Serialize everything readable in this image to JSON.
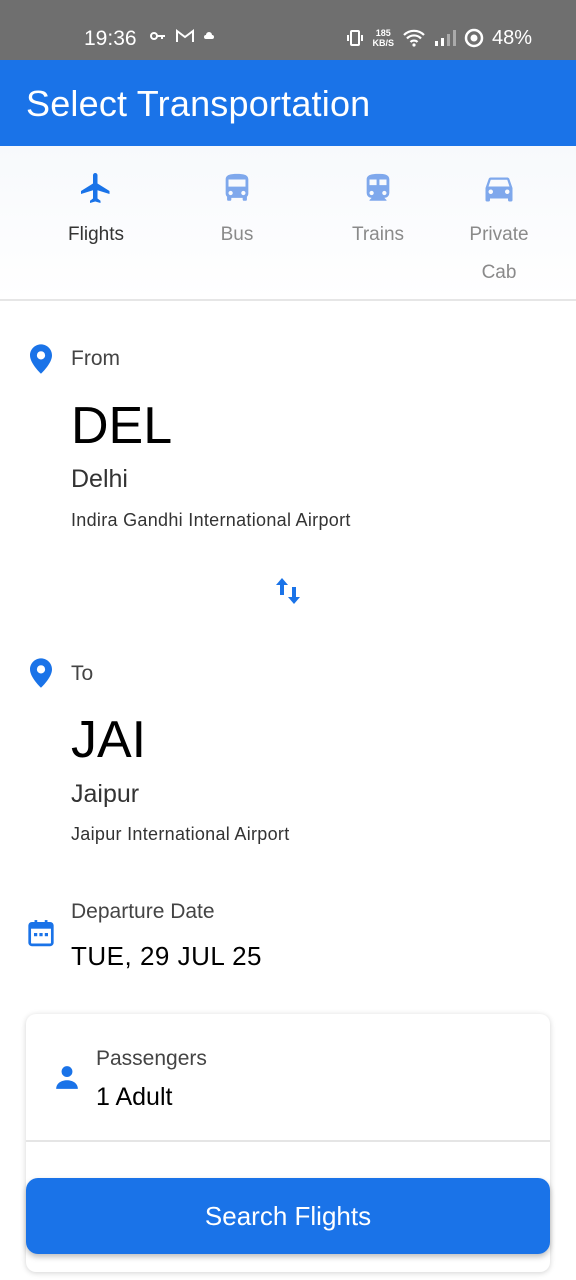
{
  "status_bar": {
    "time": "19:36",
    "speed_value": "185",
    "speed_unit": "KB/S",
    "battery": "48%"
  },
  "app_bar": {
    "title": "Select Transportation"
  },
  "tabs": [
    {
      "label": "Flights",
      "icon": "airplane-icon",
      "active": true
    },
    {
      "label": "Bus",
      "icon": "bus-icon",
      "active": false
    },
    {
      "label": "Trains",
      "icon": "train-icon",
      "active": false
    },
    {
      "label": "Private\nCab",
      "icon": "car-icon",
      "active": false
    }
  ],
  "from": {
    "label": "From",
    "code": "DEL",
    "city": "Delhi",
    "airport": "Indira Gandhi International Airport"
  },
  "to": {
    "label": "To",
    "code": "JAI",
    "city": "Jaipur",
    "airport": "Jaipur International Airport"
  },
  "departure": {
    "label": "Departure Date",
    "value": "TUE, 29 JUL 25"
  },
  "passengers": {
    "label": "Passengers",
    "value": "1 Adult"
  },
  "search_button": {
    "label": "Search Flights"
  },
  "colors": {
    "accent": "#1a73e8",
    "status_bar": "#6f6f6f",
    "inactive_tab": "#8a8a8a"
  }
}
